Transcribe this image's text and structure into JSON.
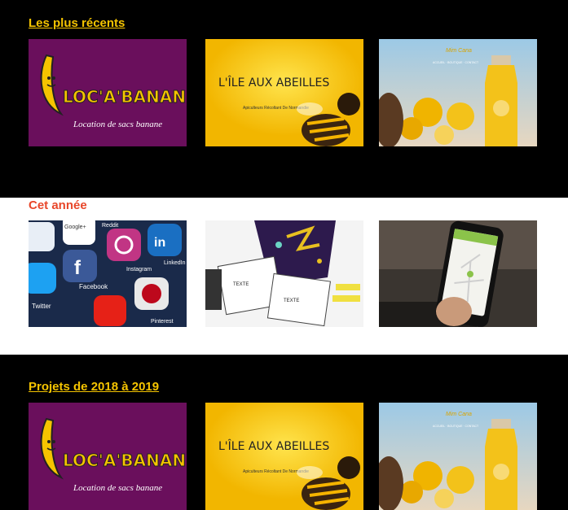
{
  "sections": [
    {
      "title": "Les plus récents",
      "tiles": [
        {
          "icon": "banana-logo",
          "logo": "LOC'A'BANANE",
          "tagline": "Location de sacs banane"
        },
        {
          "icon": "bee",
          "title": "L'ÎLE AUX ABEILLES",
          "subtitle": "Apiculteurs Récoltant De Normandie"
        },
        {
          "icon": "juice-bottle",
          "brand": "Mim Cana",
          "nav": "ACCUEIL · BOUTIQUE · CONTACT"
        }
      ]
    },
    {
      "title": "Cet année",
      "tiles": [
        {
          "icon": "social-media-apps",
          "labels": [
            "Google+",
            "Reddit",
            "Facebook",
            "Instagram",
            "LinkedIn",
            "Twitter",
            "Pinterest"
          ]
        },
        {
          "icon": "storyboard-sketches",
          "labels": [
            "TEXTE",
            "TEXTE"
          ]
        },
        {
          "icon": "phone-map-app"
        }
      ]
    },
    {
      "title": "Projets de 2018 à 2019",
      "tiles": [
        {
          "icon": "banana-logo",
          "logo": "LOC'A'BANANE",
          "tagline": "Location de sacs banane"
        },
        {
          "icon": "bee",
          "title": "L'ÎLE AUX ABEILLES",
          "subtitle": "Apiculteurs Récoltant De Normandie"
        },
        {
          "icon": "juice-bottle",
          "brand": "Mim Cana",
          "nav": "ACCUEIL · BOUTIQUE · CONTACT"
        }
      ]
    }
  ]
}
